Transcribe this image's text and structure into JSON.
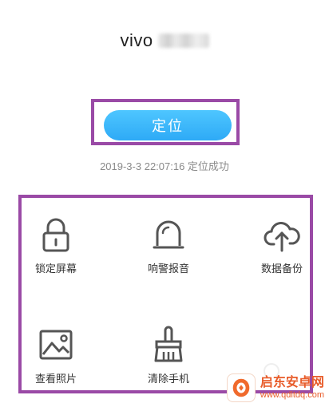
{
  "device": {
    "name": "vivo"
  },
  "locate": {
    "label": "定位"
  },
  "status": {
    "text": "2019-3-3 22:07:16 定位成功"
  },
  "features": [
    {
      "label": "锁定屏幕",
      "icon": "lock-icon"
    },
    {
      "label": "响警报音",
      "icon": "alarm-bell-icon"
    },
    {
      "label": "数据备份",
      "icon": "cloud-upload-icon"
    },
    {
      "label": "查看照片",
      "icon": "photo-icon"
    },
    {
      "label": "清除手机",
      "icon": "brush-icon"
    }
  ],
  "watermark": {
    "title": "启东安卓网",
    "url": "www.qdltdq.com"
  },
  "colors": {
    "accent_blue": "#2eaaf6",
    "highlight_purple": "#9a4aa6",
    "icon_gray": "#555555"
  }
}
